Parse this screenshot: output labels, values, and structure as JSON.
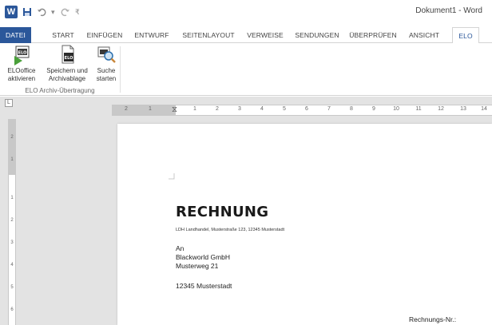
{
  "titlebar": {
    "title": "Dokument1 - Word",
    "app_icon": "W",
    "save_icon": "save-icon",
    "undo_icon": "undo-icon",
    "redo_icon": "redo-icon",
    "customize_icon": "customize-qat-icon"
  },
  "tabs": [
    "DATEI",
    "START",
    "EINFÜGEN",
    "ENTWURF",
    "SEITENLAYOUT",
    "VERWEISE",
    "SENDUNGEN",
    "ÜBERPRÜFEN",
    "ANSICHT",
    "ELO"
  ],
  "ribbon": {
    "active_tab": "ELO",
    "buttons": [
      {
        "line1": "ELOoffice",
        "line2": "aktivieren",
        "icon": "elo-activate-icon"
      },
      {
        "line1": "Speichern und",
        "line2": "Archivablage",
        "icon": "save-archive-icon"
      },
      {
        "line1": "Suche",
        "line2": "starten",
        "icon": "search-start-icon"
      }
    ],
    "group_label": "ELO Archiv-Übertragung"
  },
  "ruler": {
    "corner": "L",
    "h_numbers": [
      "2",
      "1",
      "1",
      "2",
      "3",
      "4",
      "5",
      "6",
      "7",
      "8",
      "9",
      "10",
      "11",
      "12",
      "13",
      "14"
    ],
    "v_numbers": [
      "2",
      "1",
      "1",
      "2",
      "3",
      "4",
      "5",
      "6"
    ]
  },
  "document": {
    "title": "RECHNUNG",
    "sender": "LDH Landhandel, Musterstraße 123, 12345 Musterstadt",
    "recipient_lines": [
      "An",
      "Blackworld GmbH",
      "Musterweg 21"
    ],
    "city_line": "12345 Musterstadt",
    "invoice_no_label": "Rechnungs-Nr.:"
  },
  "colors": {
    "word_blue": "#2b579a",
    "workspace_gray": "#e3e3e3"
  }
}
